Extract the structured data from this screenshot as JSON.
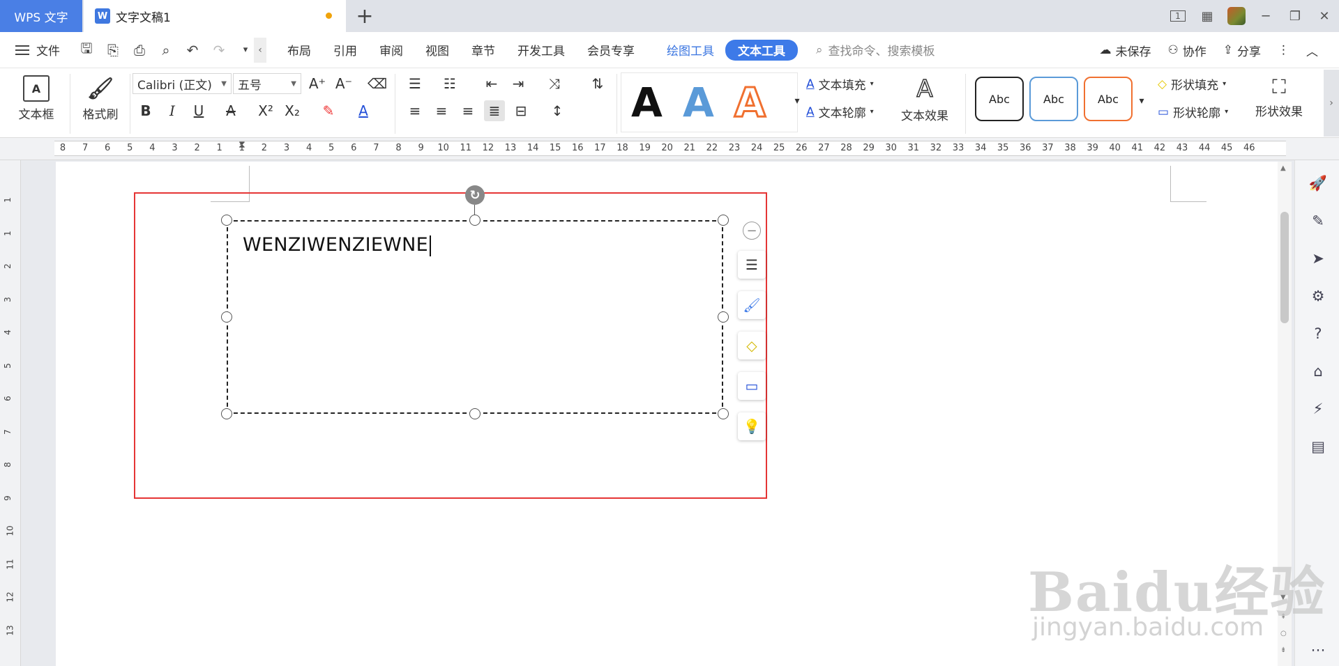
{
  "titlebar": {
    "app_name": "WPS 文字",
    "doc_title": "文字文稿1",
    "doc_icon": "W",
    "new_tab": "+",
    "page_indicator": "1"
  },
  "menubar": {
    "file": "文件",
    "items": [
      "布局",
      "引用",
      "审阅",
      "视图",
      "章节",
      "开发工具",
      "会员专享"
    ],
    "drawing_tools": "绘图工具",
    "text_tools": "文本工具",
    "search_placeholder": "查找命令、搜索模板",
    "unsaved": "未保存",
    "collaborate": "协作",
    "share": "分享"
  },
  "ribbon": {
    "textbox": "文本框",
    "format_painter": "格式刷",
    "font_name": "Calibri (正文)",
    "font_size": "五号",
    "text_fill": "文本填充",
    "text_outline": "文本轮廓",
    "text_effects": "文本效果",
    "shape_fill": "形状填充",
    "shape_outline": "形状轮廓",
    "shape_effects": "形状效果",
    "style_letter": "A",
    "abc": "Abc",
    "colors": {
      "accent": "#3d7ae8",
      "fill_orange": "#f07030",
      "fill_blue": "#5a9ad8"
    }
  },
  "ruler": {
    "h_labels": [
      "8",
      "7",
      "6",
      "5",
      "4",
      "3",
      "2",
      "1",
      "1",
      "2",
      "3",
      "4",
      "5",
      "6",
      "7",
      "8",
      "9",
      "10",
      "11",
      "12",
      "13",
      "14",
      "15",
      "16",
      "17",
      "18",
      "19",
      "20",
      "21",
      "22",
      "23",
      "24",
      "25",
      "26",
      "27",
      "28",
      "29",
      "30",
      "31",
      "32",
      "33",
      "34",
      "35",
      "36",
      "37",
      "38",
      "39",
      "40",
      "41",
      "42",
      "43",
      "44",
      "45",
      "46"
    ],
    "v_labels": [
      "1",
      "1",
      "2",
      "3",
      "4",
      "5",
      "6",
      "7",
      "8",
      "9",
      "10",
      "11",
      "12",
      "13"
    ]
  },
  "document": {
    "textbox_content": "WENZIWENZIEWNE",
    "selection_color": "#e53535"
  },
  "watermark": {
    "brand": "Baidu经验",
    "url": "jingyan.baidu.com"
  }
}
